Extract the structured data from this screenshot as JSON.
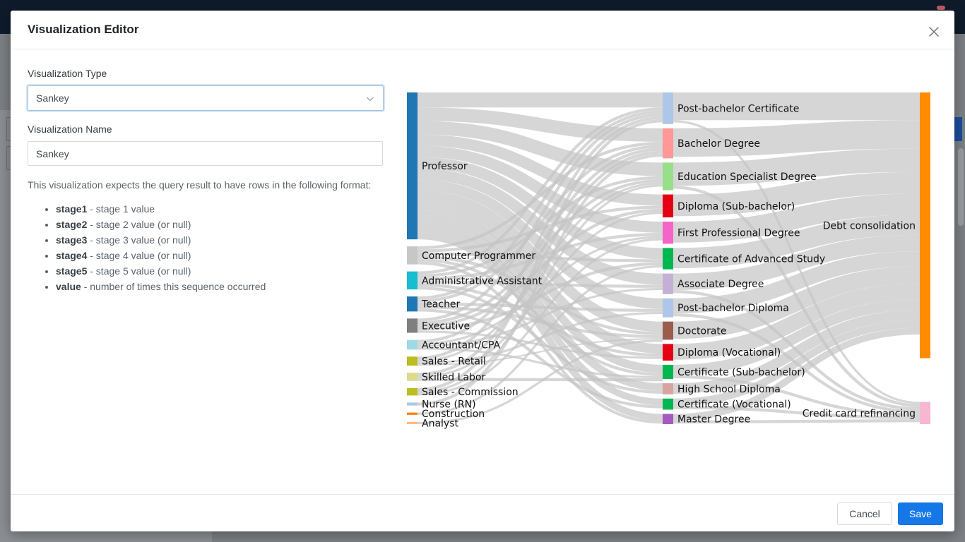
{
  "modal": {
    "title": "Visualization Editor"
  },
  "form": {
    "type_label": "Visualization Type",
    "type_value": "Sankey",
    "name_label": "Visualization Name",
    "name_value": "Sankey",
    "description": "This visualization expects the query result to have rows in the following format:",
    "format_items": [
      {
        "key": "stage1",
        "desc": " - stage 1 value"
      },
      {
        "key": "stage2",
        "desc": " - stage 2 value (or null)"
      },
      {
        "key": "stage3",
        "desc": " - stage 3 value (or null)"
      },
      {
        "key": "stage4",
        "desc": " - stage 4 value (or null)"
      },
      {
        "key": "stage5",
        "desc": " - stage 5 value (or null)"
      },
      {
        "key": "value",
        "desc": " - number of times this sequence occurred"
      }
    ]
  },
  "footer": {
    "cancel_label": "Cancel",
    "save_label": "Save"
  },
  "icons": {
    "close": "close-icon",
    "dropdown": "chevron-down-icon"
  },
  "colors": {
    "primary": "#1677e6",
    "link": "#c4c4c4"
  },
  "chart_data": {
    "type": "sankey",
    "stages": [
      [
        {
          "name": "Professor",
          "value": 196,
          "color": "#1f77b4"
        },
        {
          "name": "Computer Programmer",
          "value": 24,
          "color": "#c7c7c7"
        },
        {
          "name": "Administrative Assistant",
          "value": 24,
          "color": "#17becf"
        },
        {
          "name": "Teacher",
          "value": 20,
          "color": "#1f77b4"
        },
        {
          "name": "Executive",
          "value": 19,
          "color": "#7f7f7f"
        },
        {
          "name": "Accountant/CPA",
          "value": 13,
          "color": "#9edae5"
        },
        {
          "name": "Sales - Retail",
          "value": 12,
          "color": "#bcbd22"
        },
        {
          "name": "Skilled Labor",
          "value": 11,
          "color": "#dbdb8d"
        },
        {
          "name": "Sales - Commission",
          "value": 10,
          "color": "#bcbd22"
        },
        {
          "name": "Nurse (RN)",
          "value": 4,
          "color": "#aec7e8"
        },
        {
          "name": "Construction",
          "value": 3,
          "color": "#ff7f0e"
        },
        {
          "name": "Analyst",
          "value": 3,
          "color": "#ffbb78"
        }
      ],
      [
        {
          "name": "Post-bachelor Certificate",
          "value": 40,
          "color": "#aec7e8"
        },
        {
          "name": "Bachelor Degree",
          "value": 38,
          "color": "#ff9896"
        },
        {
          "name": "Education Specialist Degree",
          "value": 35,
          "color": "#98df8a"
        },
        {
          "name": "Diploma (Sub-bachelor)",
          "value": 29,
          "color": "#e60013"
        },
        {
          "name": "First Professional Degree",
          "value": 28,
          "color": "#f564c8"
        },
        {
          "name": "Certificate of Advanced Study",
          "value": 27,
          "color": "#00b84f"
        },
        {
          "name": "Associate Degree",
          "value": 26,
          "color": "#c5b0d5"
        },
        {
          "name": "Post-bachelor Diploma",
          "value": 24,
          "color": "#aec7e8"
        },
        {
          "name": "Doctorate",
          "value": 23,
          "color": "#9b5c4c"
        },
        {
          "name": "Diploma (Vocational)",
          "value": 21,
          "color": "#e60013"
        },
        {
          "name": "Certificate (Sub-bachelor)",
          "value": 18,
          "color": "#00b84f"
        },
        {
          "name": "High School Diploma",
          "value": 14,
          "color": "#d6a5a0"
        },
        {
          "name": "Certificate (Vocational)",
          "value": 14,
          "color": "#00b84f"
        },
        {
          "name": "Master Degree",
          "value": 13,
          "color": "#a55ac2"
        }
      ],
      [
        {
          "name": "Debt consolidation",
          "value": 323,
          "color": "#ff8c00"
        },
        {
          "name": "Credit card refinancing",
          "value": 27,
          "color": "#f7b6d2"
        }
      ]
    ],
    "links": [
      {
        "source": "Professor",
        "target": "Post-bachelor Certificate",
        "value": 20
      },
      {
        "source": "Professor",
        "target": "Bachelor Degree",
        "value": 18
      },
      {
        "source": "Professor",
        "target": "Education Specialist Degree",
        "value": 18
      },
      {
        "source": "Professor",
        "target": "Diploma (Sub-bachelor)",
        "value": 15
      },
      {
        "source": "Professor",
        "target": "First Professional Degree",
        "value": 15
      },
      {
        "source": "Professor",
        "target": "Certificate of Advanced Study",
        "value": 15
      },
      {
        "source": "Professor",
        "target": "Associate Degree",
        "value": 15
      },
      {
        "source": "Professor",
        "target": "Post-bachelor Diploma",
        "value": 14
      },
      {
        "source": "Professor",
        "target": "Doctorate",
        "value": 14
      },
      {
        "source": "Professor",
        "target": "Diploma (Vocational)",
        "value": 13
      },
      {
        "source": "Professor",
        "target": "Certificate (Sub-bachelor)",
        "value": 11
      },
      {
        "source": "Professor",
        "target": "High School Diploma",
        "value": 10
      },
      {
        "source": "Professor",
        "target": "Certificate (Vocational)",
        "value": 9
      },
      {
        "source": "Professor",
        "target": "Master Degree",
        "value": 9
      },
      {
        "source": "Computer Programmer",
        "target": "Bachelor Degree",
        "value": 4
      },
      {
        "source": "Computer Programmer",
        "target": "Diploma (Sub-bachelor)",
        "value": 4
      },
      {
        "source": "Computer Programmer",
        "target": "Certificate of Advanced Study",
        "value": 4
      },
      {
        "source": "Computer Programmer",
        "target": "Doctorate",
        "value": 4
      },
      {
        "source": "Computer Programmer",
        "target": "Certificate (Sub-bachelor)",
        "value": 4
      },
      {
        "source": "Computer Programmer",
        "target": "Master Degree",
        "value": 4
      },
      {
        "source": "Administrative Assistant",
        "target": "Post-bachelor Certificate",
        "value": 4
      },
      {
        "source": "Administrative Assistant",
        "target": "Education Specialist Degree",
        "value": 4
      },
      {
        "source": "Administrative Assistant",
        "target": "First Professional Degree",
        "value": 4
      },
      {
        "source": "Administrative Assistant",
        "target": "Associate Degree",
        "value": 4
      },
      {
        "source": "Administrative Assistant",
        "target": "Diploma (Vocational)",
        "value": 4
      },
      {
        "source": "Administrative Assistant",
        "target": "High School Diploma",
        "value": 4
      },
      {
        "source": "Teacher",
        "target": "Post-bachelor Certificate",
        "value": 4
      },
      {
        "source": "Teacher",
        "target": "Bachelor Degree",
        "value": 4
      },
      {
        "source": "Teacher",
        "target": "Post-bachelor Diploma",
        "value": 4
      },
      {
        "source": "Teacher",
        "target": "Doctorate",
        "value": 4
      },
      {
        "source": "Teacher",
        "target": "Certificate (Vocational)",
        "value": 4
      },
      {
        "source": "Executive",
        "target": "Post-bachelor Certificate",
        "value": 4
      },
      {
        "source": "Executive",
        "target": "Education Specialist Degree",
        "value": 4
      },
      {
        "source": "Executive",
        "target": "Diploma (Sub-bachelor)",
        "value": 4
      },
      {
        "source": "Executive",
        "target": "Certificate of Advanced Study",
        "value": 4
      },
      {
        "source": "Executive",
        "target": "Diploma (Vocational)",
        "value": 3
      },
      {
        "source": "Accountant/CPA",
        "target": "Bachelor Degree",
        "value": 4
      },
      {
        "source": "Accountant/CPA",
        "target": "First Professional Degree",
        "value": 3
      },
      {
        "source": "Accountant/CPA",
        "target": "Associate Degree",
        "value": 3
      },
      {
        "source": "Accountant/CPA",
        "target": "Certificate (Sub-bachelor)",
        "value": 3
      },
      {
        "source": "Sales - Retail",
        "target": "Post-bachelor Certificate",
        "value": 4
      },
      {
        "source": "Sales - Retail",
        "target": "Education Specialist Degree",
        "value": 3
      },
      {
        "source": "Sales - Retail",
        "target": "Post-bachelor Diploma",
        "value": 3
      },
      {
        "source": "Sales - Retail",
        "target": "Doctorate",
        "value": 2
      },
      {
        "source": "Skilled Labor",
        "target": "Bachelor Degree",
        "value": 4
      },
      {
        "source": "Skilled Labor",
        "target": "Diploma (Sub-bachelor)",
        "value": 3
      },
      {
        "source": "Skilled Labor",
        "target": "Certificate (Sub-bachelor)",
        "value": 4
      },
      {
        "source": "Sales - Commission",
        "target": "Post-bachelor Certificate",
        "value": 4
      },
      {
        "source": "Sales - Commission",
        "target": "Education Specialist Degree",
        "value": 3
      },
      {
        "source": "Sales - Commission",
        "target": "First Professional Degree",
        "value": 3
      },
      {
        "source": "Nurse (RN)",
        "target": "Bachelor Degree",
        "value": 4
      },
      {
        "source": "Construction",
        "target": "Certificate of Advanced Study",
        "value": 3
      },
      {
        "source": "Analyst",
        "target": "Doctorate",
        "value": 3
      },
      {
        "source": "Post-bachelor Certificate",
        "target": "Debt consolidation",
        "value": 37
      },
      {
        "source": "Post-bachelor Certificate",
        "target": "Credit card refinancing",
        "value": 3
      },
      {
        "source": "Bachelor Degree",
        "target": "Debt consolidation",
        "value": 38
      },
      {
        "source": "Education Specialist Degree",
        "target": "Debt consolidation",
        "value": 31
      },
      {
        "source": "Education Specialist Degree",
        "target": "Credit card refinancing",
        "value": 4
      },
      {
        "source": "Diploma (Sub-bachelor)",
        "target": "Debt consolidation",
        "value": 29
      },
      {
        "source": "First Professional Degree",
        "target": "Debt consolidation",
        "value": 28
      },
      {
        "source": "Certificate of Advanced Study",
        "target": "Debt consolidation",
        "value": 27
      },
      {
        "source": "Associate Degree",
        "target": "Debt consolidation",
        "value": 22
      },
      {
        "source": "Associate Degree",
        "target": "Credit card refinancing",
        "value": 4
      },
      {
        "source": "Post-bachelor Diploma",
        "target": "Debt consolidation",
        "value": 20
      },
      {
        "source": "Post-bachelor Diploma",
        "target": "Credit card refinancing",
        "value": 4
      },
      {
        "source": "Doctorate",
        "target": "Debt consolidation",
        "value": 23
      },
      {
        "source": "Diploma (Vocational)",
        "target": "Debt consolidation",
        "value": 21
      },
      {
        "source": "Certificate (Sub-bachelor)",
        "target": "Debt consolidation",
        "value": 14
      },
      {
        "source": "Certificate (Sub-bachelor)",
        "target": "Credit card refinancing",
        "value": 4
      },
      {
        "source": "High School Diploma",
        "target": "Debt consolidation",
        "value": 14
      },
      {
        "source": "Certificate (Vocational)",
        "target": "Debt consolidation",
        "value": 10
      },
      {
        "source": "Certificate (Vocational)",
        "target": "Credit card refinancing",
        "value": 4
      },
      {
        "source": "Master Degree",
        "target": "Debt consolidation",
        "value": 9
      },
      {
        "source": "Master Degree",
        "target": "Credit card refinancing",
        "value": 4
      }
    ]
  }
}
